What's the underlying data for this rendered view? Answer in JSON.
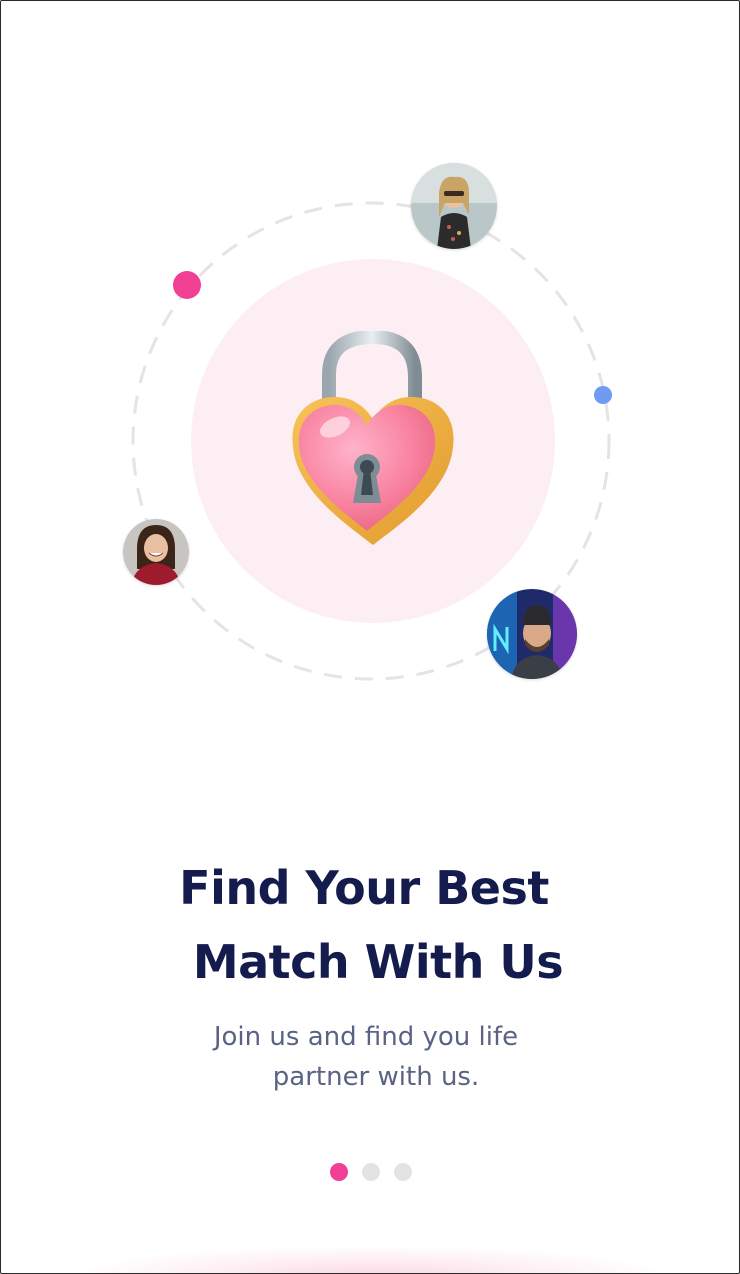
{
  "onboarding": {
    "title_line_1": "Find Your Best",
    "title_line_2": "Match With Us",
    "subtitle_line_1": "Join us and find you life",
    "subtitle_line_2": "partner with us.",
    "illustration": {
      "center_icon": "heart-padlock-icon",
      "avatars": [
        "profile-photo-woman-blonde",
        "profile-photo-woman-smiling",
        "profile-photo-man-beanie"
      ]
    },
    "pager": {
      "page_count": 3,
      "active_page": 1
    }
  },
  "colors": {
    "accent_pink": "#f23f96",
    "accent_blue": "#6f9bf3",
    "title_text": "#141b4d",
    "subtitle_text": "#5b6384",
    "inactive_dot": "#e3e3e6",
    "disc_bg": "#fdeef4"
  }
}
